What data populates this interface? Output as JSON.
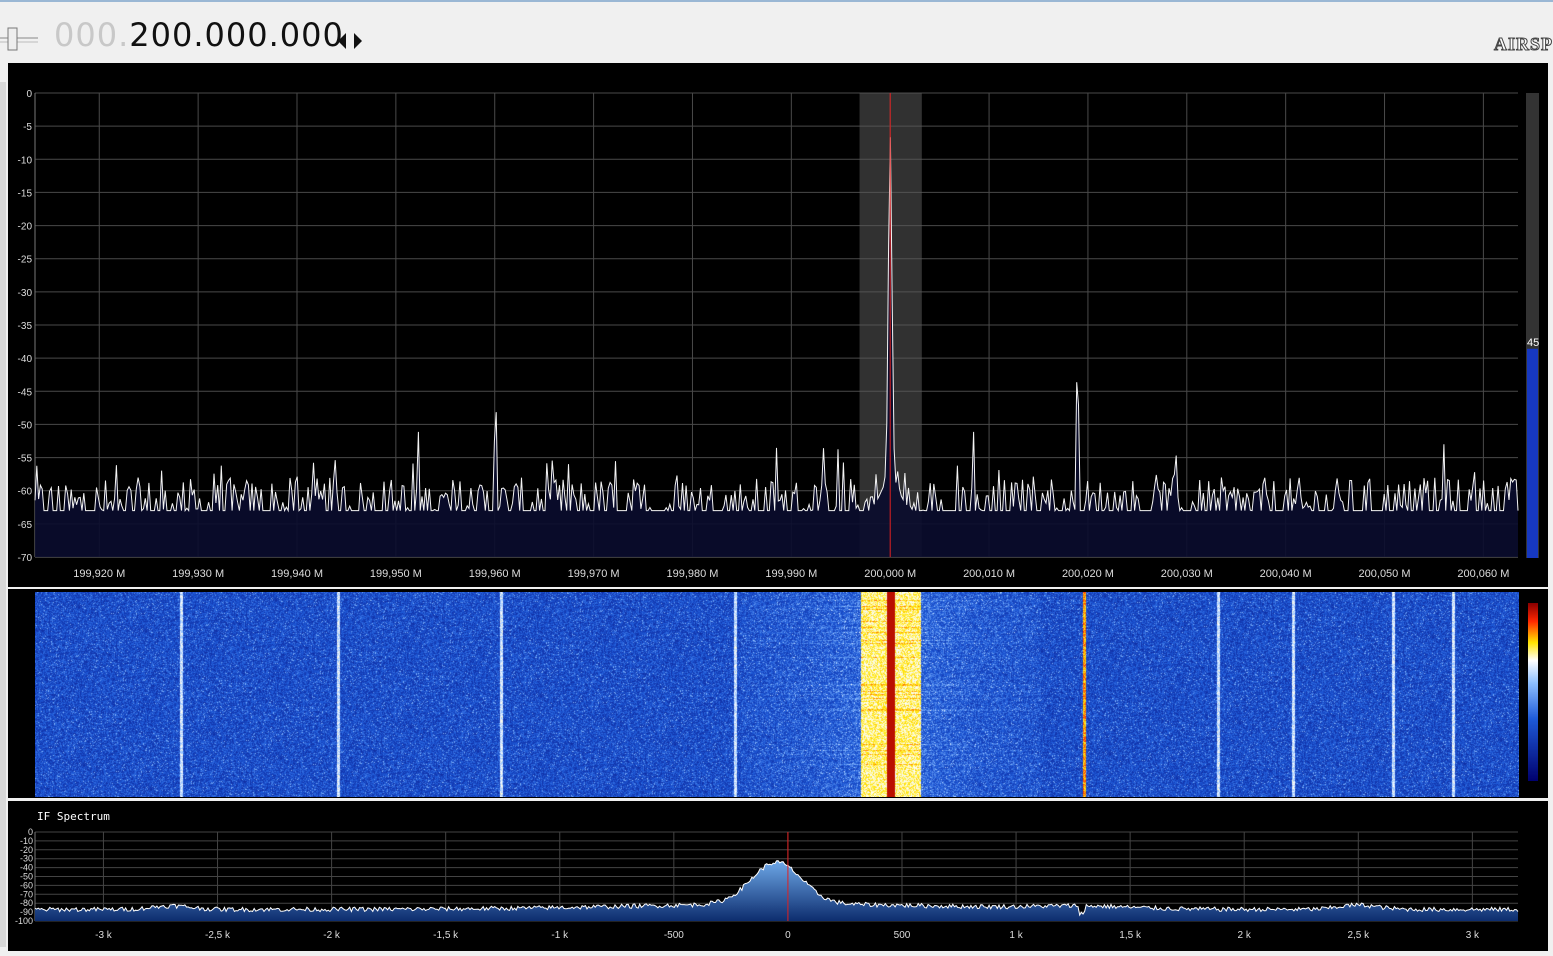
{
  "toolbar": {
    "frequency_leading": "000.",
    "frequency_main": "200.000.000",
    "logo_text": "AIRSP"
  },
  "spectrum": {
    "y_ticks": [
      "0",
      "-5",
      "-10",
      "-15",
      "-20",
      "-25",
      "-30",
      "-35",
      "-40",
      "-45",
      "-50",
      "-55",
      "-60",
      "-65",
      "-70"
    ],
    "x_ticks": [
      "199,920 M",
      "199,930 M",
      "199,940 M",
      "199,950 M",
      "199,960 M",
      "199,970 M",
      "199,980 M",
      "199,990 M",
      "200,000 M",
      "200,010 M",
      "200,020 M",
      "200,030 M",
      "200,040 M",
      "200,050 M",
      "200,060 M"
    ],
    "peak_db": -11,
    "noise_floor_db": -63,
    "secondary_peaks": [
      {
        "freq_mhz": 200.019,
        "db": -49
      },
      {
        "freq_mhz": 199.96,
        "db": -54
      },
      {
        "freq_mhz": 200.056,
        "db": -53
      }
    ],
    "center_mhz": 200.0,
    "filter_low_khz": -3.1,
    "filter_high_khz": 3.2,
    "gauge_value": "45",
    "gauge_fraction": 0.45
  },
  "waterfall": {
    "colors": [
      "#00006e",
      "#1e5ad8",
      "#ffffff",
      "#ffe600",
      "#ff2800",
      "#8c0000"
    ]
  },
  "if_spectrum": {
    "title": "IF Spectrum",
    "y_ticks": [
      "0",
      "-10",
      "-20",
      "-30",
      "-40",
      "-50",
      "-60",
      "-70",
      "-80",
      "-90",
      "-100"
    ],
    "x_ticks": [
      "-3 k",
      "-2,5 k",
      "-2 k",
      "-1,5 k",
      "-1 k",
      "-500",
      "0",
      "500",
      "1 k",
      "1,5 k",
      "2 k",
      "2,5 k",
      "3 k"
    ],
    "peak_db": -40,
    "noise_floor_db": -87
  }
}
